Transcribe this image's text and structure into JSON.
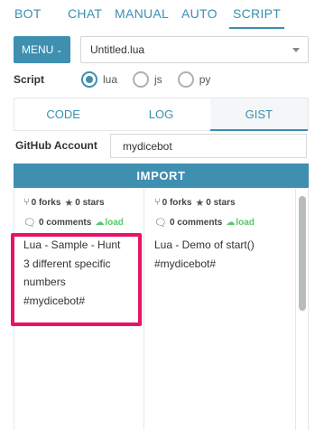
{
  "nav": {
    "items": [
      {
        "label": "BOT",
        "active": false
      },
      {
        "label": "CHAT",
        "active": false
      },
      {
        "label": "MANUAL",
        "active": false
      },
      {
        "label": "AUTO",
        "active": false
      },
      {
        "label": "SCRIPT",
        "active": true
      }
    ]
  },
  "toolbar": {
    "menu_label": "MENU",
    "menu_caret": "⌄",
    "file_name": "Untitled.lua"
  },
  "script": {
    "label": "Script",
    "options": [
      {
        "label": "lua",
        "checked": true
      },
      {
        "label": "js",
        "checked": false
      },
      {
        "label": "py",
        "checked": false
      }
    ]
  },
  "subtabs": [
    {
      "label": "CODE",
      "active": false
    },
    {
      "label": "LOG",
      "active": false
    },
    {
      "label": "GIST",
      "active": true
    }
  ],
  "account": {
    "label": "GitHub Account",
    "value": "mydicebot"
  },
  "import_label": "IMPORT",
  "gists": [
    {
      "forks": "0 forks",
      "stars": "0 stars",
      "comments": "0 comments",
      "load": "load",
      "description_lines": [
        "Lua - Sample - Hunt",
        "3 different specific",
        "numbers",
        "#mydicebot#"
      ]
    },
    {
      "forks": "0 forks",
      "stars": "0 stars",
      "comments": "0 comments",
      "load": "load",
      "description_lines": [
        "Lua - Demo of start()",
        "#mydicebot#"
      ]
    }
  ],
  "colors": {
    "accent": "#3f8fb1",
    "load_green": "#56c96a",
    "highlight": "#e8126b"
  },
  "icons": {
    "fork": "fork-icon",
    "star": "star-icon",
    "comment": "comment-icon",
    "cloud": "cloud-download-icon"
  }
}
